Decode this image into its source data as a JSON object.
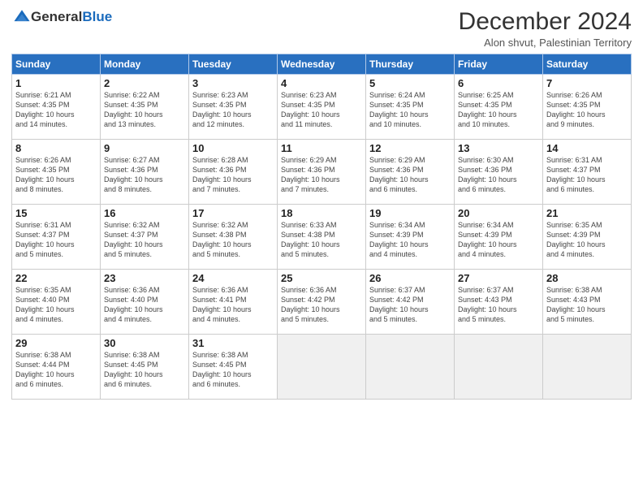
{
  "logo": {
    "general": "General",
    "blue": "Blue"
  },
  "title": "December 2024",
  "location": "Alon shvut, Palestinian Territory",
  "weekdays": [
    "Sunday",
    "Monday",
    "Tuesday",
    "Wednesday",
    "Thursday",
    "Friday",
    "Saturday"
  ],
  "weeks": [
    [
      {
        "day": "1",
        "sunrise": "6:21 AM",
        "sunset": "4:35 PM",
        "daylight": "10 hours and 14 minutes."
      },
      {
        "day": "2",
        "sunrise": "6:22 AM",
        "sunset": "4:35 PM",
        "daylight": "10 hours and 13 minutes."
      },
      {
        "day": "3",
        "sunrise": "6:23 AM",
        "sunset": "4:35 PM",
        "daylight": "10 hours and 12 minutes."
      },
      {
        "day": "4",
        "sunrise": "6:23 AM",
        "sunset": "4:35 PM",
        "daylight": "10 hours and 11 minutes."
      },
      {
        "day": "5",
        "sunrise": "6:24 AM",
        "sunset": "4:35 PM",
        "daylight": "10 hours and 10 minutes."
      },
      {
        "day": "6",
        "sunrise": "6:25 AM",
        "sunset": "4:35 PM",
        "daylight": "10 hours and 10 minutes."
      },
      {
        "day": "7",
        "sunrise": "6:26 AM",
        "sunset": "4:35 PM",
        "daylight": "10 hours and 9 minutes."
      }
    ],
    [
      {
        "day": "8",
        "sunrise": "6:26 AM",
        "sunset": "4:35 PM",
        "daylight": "10 hours and 8 minutes."
      },
      {
        "day": "9",
        "sunrise": "6:27 AM",
        "sunset": "4:36 PM",
        "daylight": "10 hours and 8 minutes."
      },
      {
        "day": "10",
        "sunrise": "6:28 AM",
        "sunset": "4:36 PM",
        "daylight": "10 hours and 7 minutes."
      },
      {
        "day": "11",
        "sunrise": "6:29 AM",
        "sunset": "4:36 PM",
        "daylight": "10 hours and 7 minutes."
      },
      {
        "day": "12",
        "sunrise": "6:29 AM",
        "sunset": "4:36 PM",
        "daylight": "10 hours and 6 minutes."
      },
      {
        "day": "13",
        "sunrise": "6:30 AM",
        "sunset": "4:36 PM",
        "daylight": "10 hours and 6 minutes."
      },
      {
        "day": "14",
        "sunrise": "6:31 AM",
        "sunset": "4:37 PM",
        "daylight": "10 hours and 6 minutes."
      }
    ],
    [
      {
        "day": "15",
        "sunrise": "6:31 AM",
        "sunset": "4:37 PM",
        "daylight": "10 hours and 5 minutes."
      },
      {
        "day": "16",
        "sunrise": "6:32 AM",
        "sunset": "4:37 PM",
        "daylight": "10 hours and 5 minutes."
      },
      {
        "day": "17",
        "sunrise": "6:32 AM",
        "sunset": "4:38 PM",
        "daylight": "10 hours and 5 minutes."
      },
      {
        "day": "18",
        "sunrise": "6:33 AM",
        "sunset": "4:38 PM",
        "daylight": "10 hours and 5 minutes."
      },
      {
        "day": "19",
        "sunrise": "6:34 AM",
        "sunset": "4:39 PM",
        "daylight": "10 hours and 4 minutes."
      },
      {
        "day": "20",
        "sunrise": "6:34 AM",
        "sunset": "4:39 PM",
        "daylight": "10 hours and 4 minutes."
      },
      {
        "day": "21",
        "sunrise": "6:35 AM",
        "sunset": "4:39 PM",
        "daylight": "10 hours and 4 minutes."
      }
    ],
    [
      {
        "day": "22",
        "sunrise": "6:35 AM",
        "sunset": "4:40 PM",
        "daylight": "10 hours and 4 minutes."
      },
      {
        "day": "23",
        "sunrise": "6:36 AM",
        "sunset": "4:40 PM",
        "daylight": "10 hours and 4 minutes."
      },
      {
        "day": "24",
        "sunrise": "6:36 AM",
        "sunset": "4:41 PM",
        "daylight": "10 hours and 4 minutes."
      },
      {
        "day": "25",
        "sunrise": "6:36 AM",
        "sunset": "4:42 PM",
        "daylight": "10 hours and 5 minutes."
      },
      {
        "day": "26",
        "sunrise": "6:37 AM",
        "sunset": "4:42 PM",
        "daylight": "10 hours and 5 minutes."
      },
      {
        "day": "27",
        "sunrise": "6:37 AM",
        "sunset": "4:43 PM",
        "daylight": "10 hours and 5 minutes."
      },
      {
        "day": "28",
        "sunrise": "6:38 AM",
        "sunset": "4:43 PM",
        "daylight": "10 hours and 5 minutes."
      }
    ],
    [
      {
        "day": "29",
        "sunrise": "6:38 AM",
        "sunset": "4:44 PM",
        "daylight": "10 hours and 6 minutes."
      },
      {
        "day": "30",
        "sunrise": "6:38 AM",
        "sunset": "4:45 PM",
        "daylight": "10 hours and 6 minutes."
      },
      {
        "day": "31",
        "sunrise": "6:38 AM",
        "sunset": "4:45 PM",
        "daylight": "10 hours and 6 minutes."
      },
      null,
      null,
      null,
      null
    ]
  ]
}
